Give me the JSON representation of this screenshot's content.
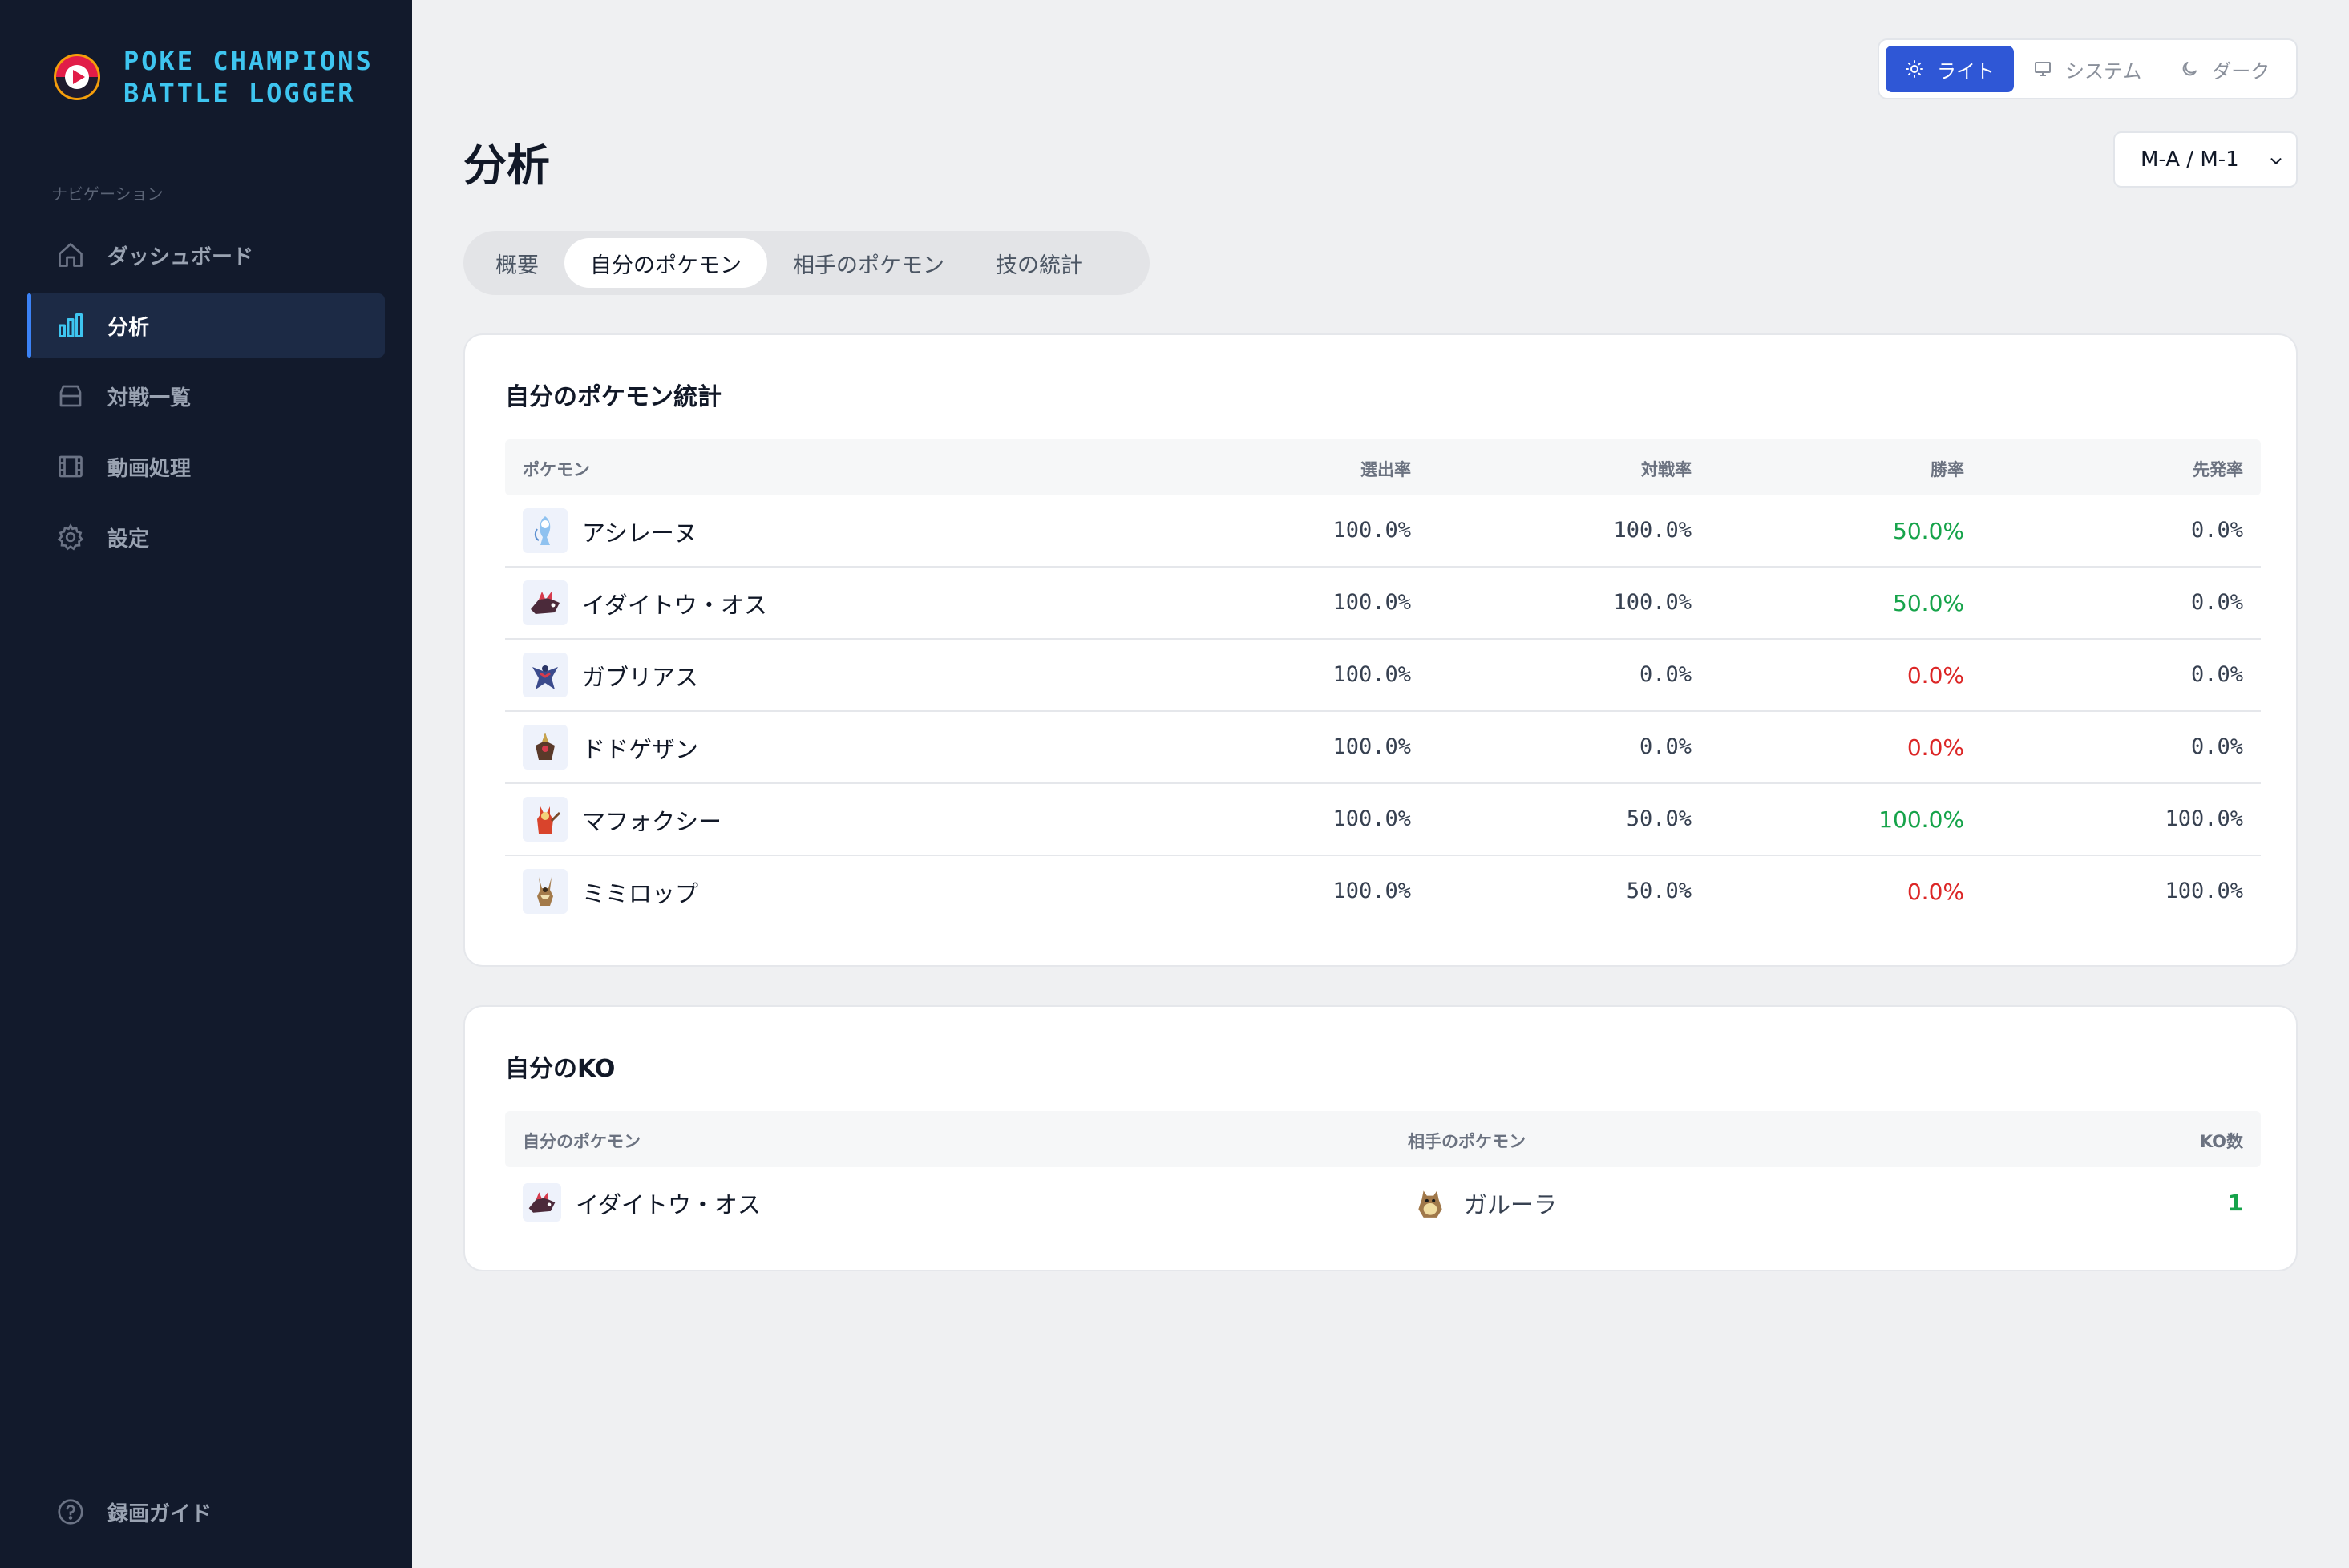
{
  "app": {
    "title_line1": "POKE CHAMPIONS",
    "title_line2": "BATTLE LOGGER"
  },
  "sidebar": {
    "caption": "ナビゲーション",
    "items": [
      {
        "label": "ダッシュボード",
        "icon": "home-icon"
      },
      {
        "label": "分析",
        "icon": "bar-chart-icon",
        "active": true
      },
      {
        "label": "対戦一覧",
        "icon": "archive-icon"
      },
      {
        "label": "動画処理",
        "icon": "film-icon"
      },
      {
        "label": "設定",
        "icon": "gear-icon"
      }
    ],
    "footer": {
      "label": "録画ガイド",
      "icon": "help-circle-icon"
    }
  },
  "theme": {
    "light": "ライト",
    "system": "システム",
    "dark": "ダーク",
    "selected": "light"
  },
  "page": {
    "title": "分析"
  },
  "season_select": {
    "value": "M-A / M-1"
  },
  "tabs": [
    {
      "label": "概要"
    },
    {
      "label": "自分のポケモン",
      "active": true
    },
    {
      "label": "相手のポケモン"
    },
    {
      "label": "技の統計"
    }
  ],
  "stats_card": {
    "title": "自分のポケモン統計",
    "headers": {
      "pokemon": "ポケモン",
      "pick": "選出率",
      "battle": "対戦率",
      "win": "勝率",
      "lead": "先発率"
    },
    "rows": [
      {
        "name": "アシレーヌ",
        "pick": "100.0%",
        "battle": "100.0%",
        "win": "50.0%",
        "win_state": "green",
        "lead": "0.0%"
      },
      {
        "name": "イダイトウ・オス",
        "pick": "100.0%",
        "battle": "100.0%",
        "win": "50.0%",
        "win_state": "green",
        "lead": "0.0%"
      },
      {
        "name": "ガブリアス",
        "pick": "100.0%",
        "battle": "0.0%",
        "win": "0.0%",
        "win_state": "red",
        "lead": "0.0%"
      },
      {
        "name": "ドドゲザン",
        "pick": "100.0%",
        "battle": "0.0%",
        "win": "0.0%",
        "win_state": "red",
        "lead": "0.0%"
      },
      {
        "name": "マフォクシー",
        "pick": "100.0%",
        "battle": "50.0%",
        "win": "100.0%",
        "win_state": "green",
        "lead": "100.0%"
      },
      {
        "name": "ミミロップ",
        "pick": "100.0%",
        "battle": "50.0%",
        "win": "0.0%",
        "win_state": "red",
        "lead": "100.0%"
      }
    ]
  },
  "ko_card": {
    "title": "自分のKO",
    "headers": {
      "mine": "自分のポケモン",
      "opponent": "相手のポケモン",
      "count": "KO数"
    },
    "rows": [
      {
        "mine": "イダイトウ・オス",
        "opponent": "ガルーラ",
        "count": "1"
      }
    ]
  },
  "colors": {
    "accent": "#2f57d6",
    "sidebar_bg": "#121a2c",
    "brand_text": "#3ec5f0",
    "win_green": "#16a34a",
    "loss_red": "#dc2626"
  }
}
